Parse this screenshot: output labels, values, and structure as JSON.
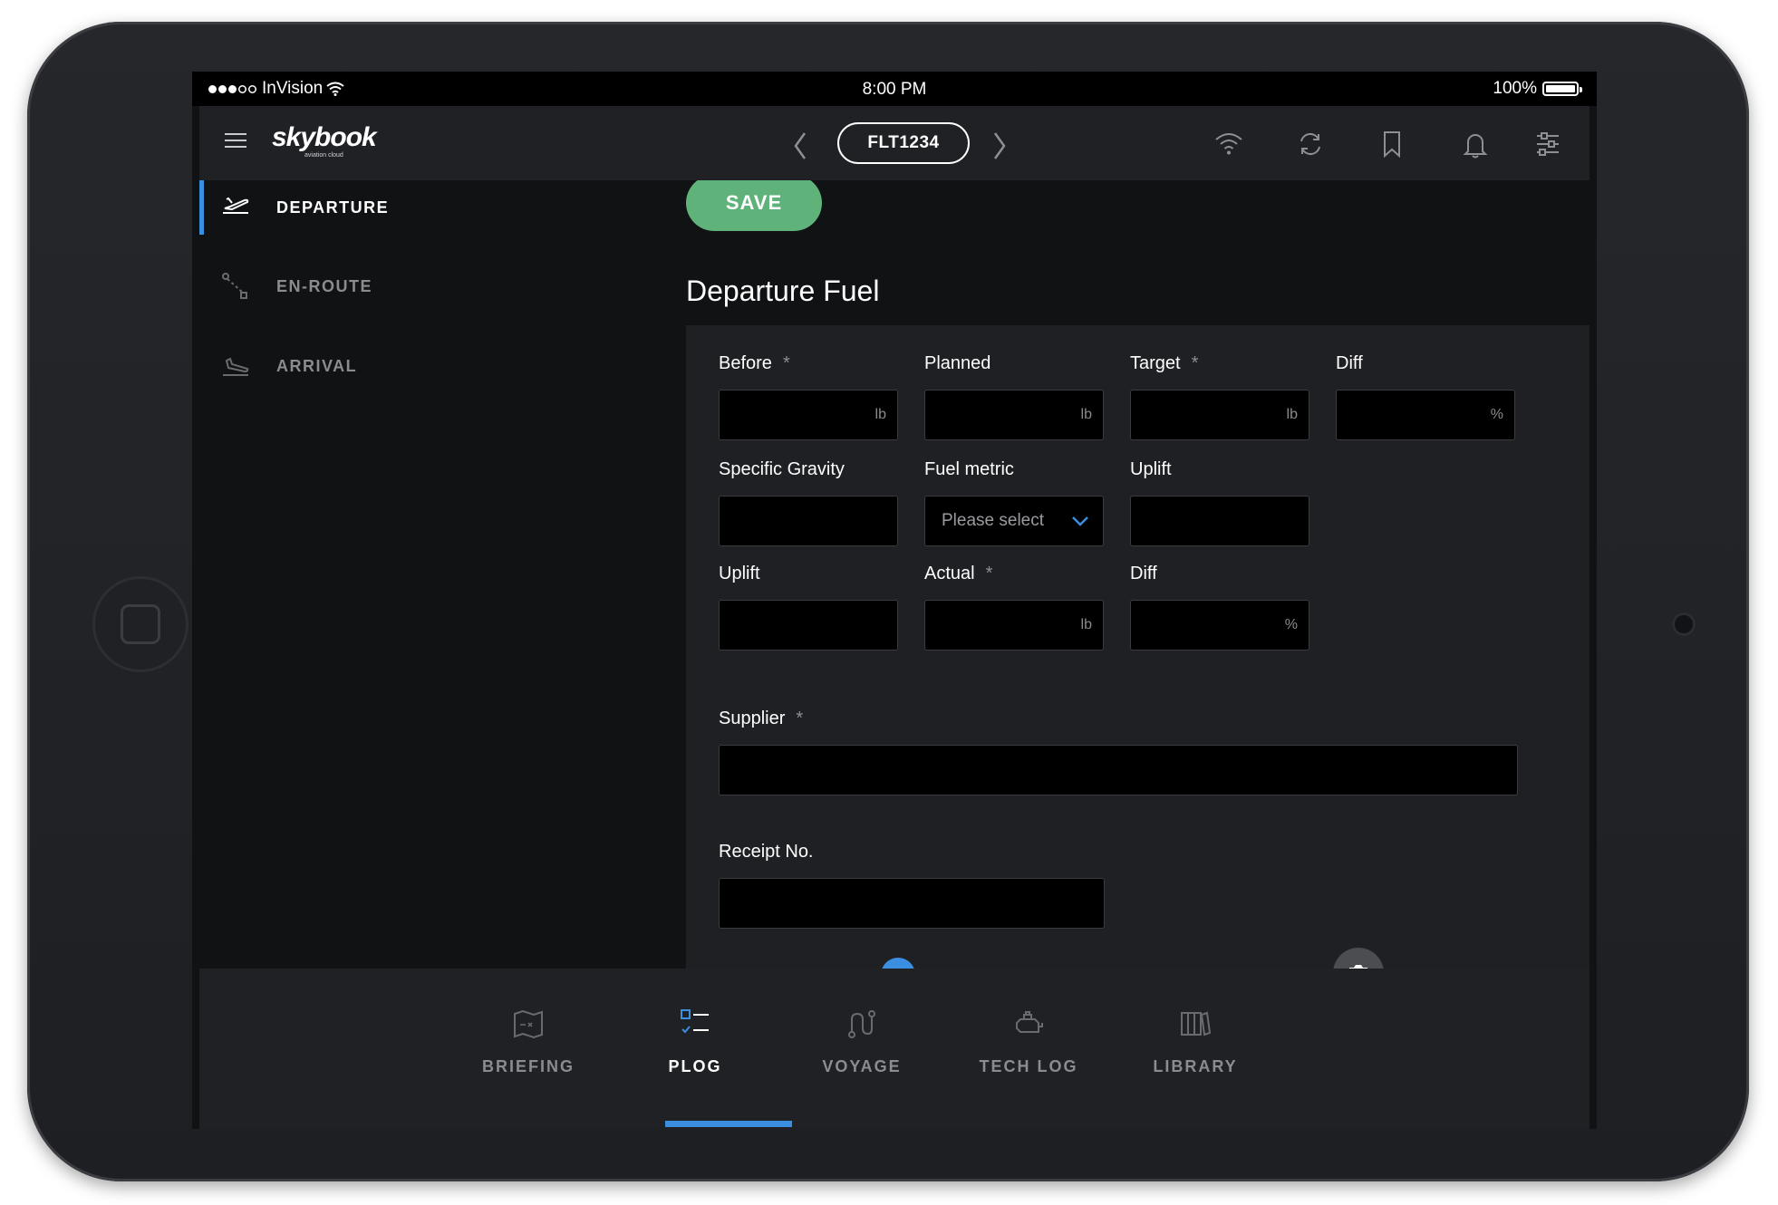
{
  "status_bar": {
    "carrier": "InVision",
    "time": "8:00 PM",
    "battery": "100%"
  },
  "header": {
    "logo": "skybook",
    "logo_tagline": "aviation cloud",
    "flight": "FLT1234"
  },
  "sidebar": {
    "items": [
      {
        "label": "DEPARTURE",
        "icon": "departure-icon",
        "active": true
      },
      {
        "label": "EN-ROUTE",
        "icon": "route-icon",
        "active": false
      },
      {
        "label": "ARRIVAL",
        "icon": "arrival-icon",
        "active": false
      }
    ]
  },
  "main": {
    "save_label": "SAVE",
    "section_title": "Departure Fuel",
    "fields": {
      "before": {
        "label": "Before",
        "required": "*",
        "unit": "lb",
        "value": ""
      },
      "planned": {
        "label": "Planned",
        "unit": "lb",
        "value": ""
      },
      "target": {
        "label": "Target",
        "required": "*",
        "unit": "lb",
        "value": ""
      },
      "diff1": {
        "label": "Diff",
        "unit": "%",
        "value": ""
      },
      "specific_gravity": {
        "label": "Specific Gravity",
        "value": ""
      },
      "fuel_metric": {
        "label": "Fuel metric",
        "placeholder": "Please select"
      },
      "uplift1": {
        "label": "Uplift",
        "value": ""
      },
      "uplift2": {
        "label": "Uplift",
        "value": ""
      },
      "actual": {
        "label": "Actual",
        "required": "*",
        "unit": "lb",
        "value": ""
      },
      "diff2": {
        "label": "Diff",
        "unit": "%",
        "value": ""
      },
      "supplier": {
        "label": "Supplier",
        "required": "*",
        "value": ""
      },
      "receipt_no": {
        "label": "Receipt No.",
        "value": ""
      }
    }
  },
  "tabs": [
    {
      "label": "BRIEFING",
      "icon": "map-icon",
      "active": false
    },
    {
      "label": "PLOG",
      "icon": "checklist-icon",
      "active": true
    },
    {
      "label": "VOYAGE",
      "icon": "voyage-icon",
      "active": false
    },
    {
      "label": "TECH LOG",
      "icon": "engine-icon",
      "active": false
    },
    {
      "label": "LIBRARY",
      "icon": "library-icon",
      "active": false
    }
  ],
  "colors": {
    "accent": "#3b8fe0",
    "save": "#5fb37a",
    "background": "#111214",
    "panel": "#1f2024"
  }
}
